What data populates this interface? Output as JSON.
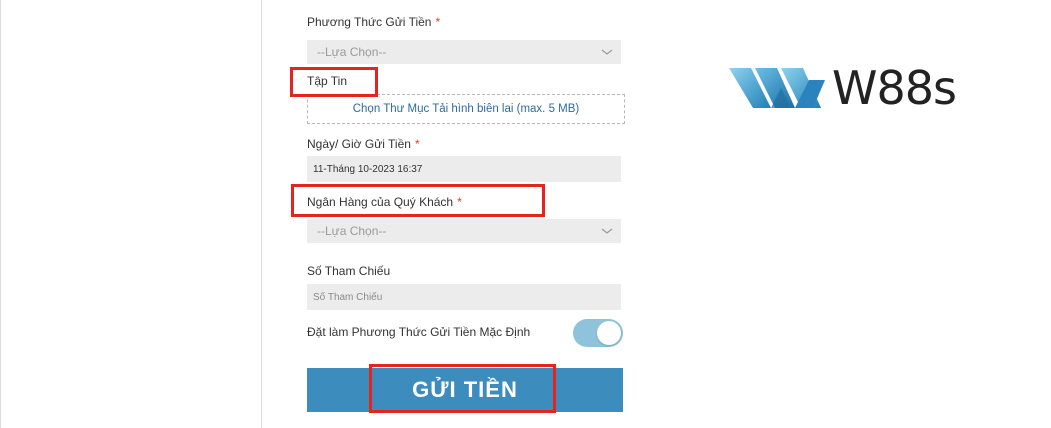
{
  "form": {
    "method_label": "Phương Thức Gửi Tiền",
    "method_value": "--Lựa Chọn--",
    "file_label": "Tập Tin",
    "upload_text": "Chọn Thư Mục Tải hình biên lai (max. 5 MB)",
    "date_label": "Ngày/ Giờ Gửi Tiền",
    "date_value": "11-Tháng 10-2023 16:37",
    "bank_label": "Ngân Hàng của Quý Khách",
    "bank_value": "--Lựa Chọn--",
    "ref_label": "Số Tham Chiếu",
    "ref_placeholder": "Số Tham Chiếu",
    "default_label": "Đặt làm Phương Thức Gửi Tiền Mặc Định",
    "default_on": true,
    "required_mark": "*",
    "submit_label": "GỬI TIỀN"
  },
  "logo": {
    "text": "W88s",
    "icon": "w88-chevron-logo"
  },
  "colors": {
    "accent": "#3c8cbd",
    "toggle": "#8fc3dc",
    "highlight": "#e3251d",
    "required": "#e03c31",
    "link": "#2d6ca2"
  }
}
